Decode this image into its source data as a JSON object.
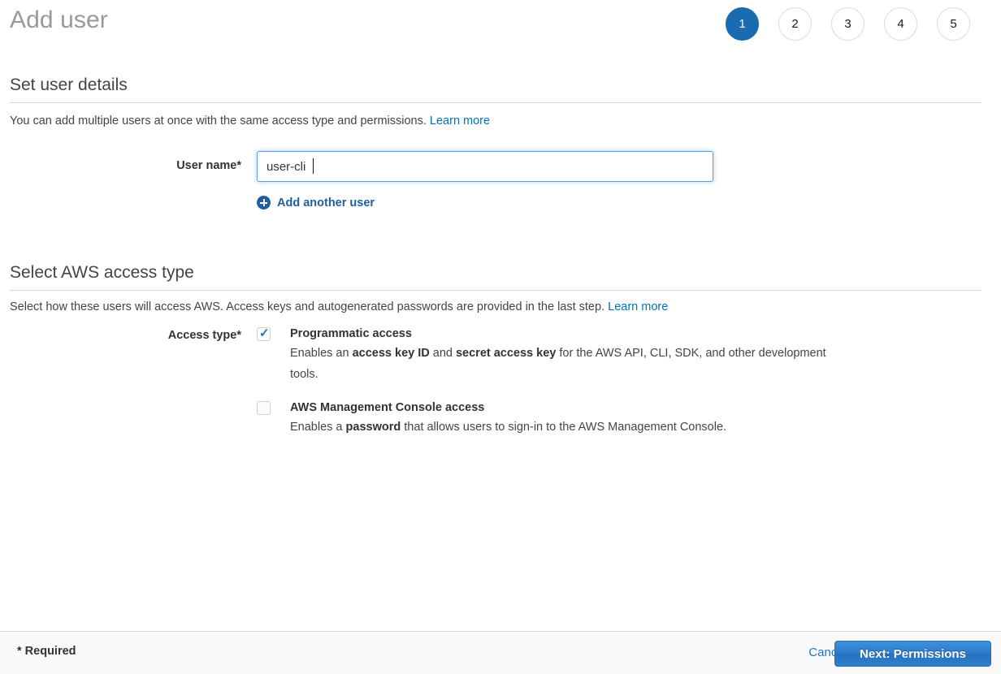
{
  "header": {
    "title": "Add user",
    "steps": [
      {
        "label": "1",
        "active": true
      },
      {
        "label": "2",
        "active": false
      },
      {
        "label": "3",
        "active": false
      },
      {
        "label": "4",
        "active": false
      },
      {
        "label": "5",
        "active": false
      }
    ]
  },
  "user_details": {
    "section_title": "Set user details",
    "description": "You can add multiple users at once with the same access type and permissions.",
    "learn_more": "Learn more",
    "username_label": "User name*",
    "username_value": "user-cli",
    "username_placeholder": "",
    "add_another_label": "Add another user",
    "add_another_icon": "plus-circle-icon"
  },
  "access_type": {
    "section_title": "Select AWS access type",
    "description": "Select how these users will access AWS. Access keys and autogenerated passwords are provided in the last step.",
    "learn_more": "Learn more",
    "field_label": "Access type*",
    "options": [
      {
        "title": "Programmatic access",
        "checked": true,
        "desc_part1": "Enables an ",
        "desc_bold1": "access key ID",
        "desc_part2": " and ",
        "desc_bold2": "secret access key",
        "desc_part3": " for the AWS API, CLI, SDK, and other development tools."
      },
      {
        "title": "AWS Management Console access",
        "checked": false,
        "desc_part1": "Enables a ",
        "desc_bold1": "password",
        "desc_part2": " that allows users to sign-in to the AWS Management Console.",
        "desc_bold2": "",
        "desc_part3": ""
      }
    ]
  },
  "footer": {
    "required_note": "* Required",
    "cancel_label": "Cancel",
    "next_label": "Next: Permissions"
  },
  "colors": {
    "accent_blue": "#1a6cb0",
    "link_blue": "#0073bb",
    "button_blue": "#2c7bc8",
    "title_gray": "#999999",
    "text_gray": "#444444"
  }
}
